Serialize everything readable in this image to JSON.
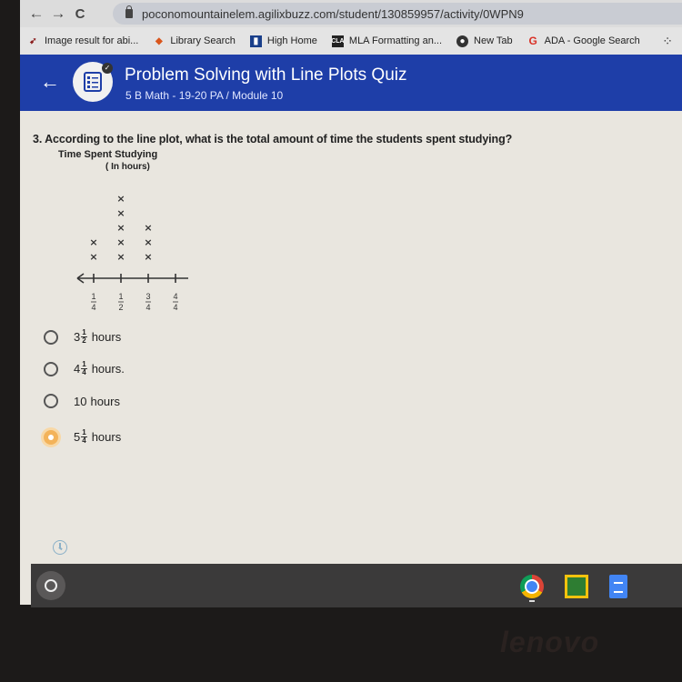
{
  "browser": {
    "url": "poconomountainelem.agilixbuzz.com/student/130859957/activity/0WPN9",
    "bookmarks": [
      {
        "label": "Image result for abi...",
        "icon": "arrow-bookmark-icon"
      },
      {
        "label": "Library Search",
        "icon": "diamond-icon"
      },
      {
        "label": "High Home",
        "icon": "building-icon"
      },
      {
        "label": "MLA Formatting an...",
        "icon": "cla-icon"
      },
      {
        "label": "New Tab",
        "icon": "globe-icon"
      },
      {
        "label": "ADA - Google Search",
        "icon": "google-icon"
      }
    ],
    "nav": {
      "back": "←",
      "forward": "→",
      "reload": "C"
    }
  },
  "header": {
    "back": "←",
    "title": "Problem Solving with Line Plots Quiz",
    "subtitle": "5 B Math - 19-20 PA / Module 10"
  },
  "question": {
    "text": "3. According to the line plot, what is the total amount of time the students spent studying?",
    "plot_title": "Time Spent Studying",
    "plot_subtitle": "( In hours)"
  },
  "chart_data": {
    "type": "scatter",
    "subtype": "line-plot",
    "title": "Time Spent Studying",
    "subtitle": "( In hours)",
    "categories": [
      "1/4",
      "1/2",
      "3/4",
      "4/4"
    ],
    "tick_labels": [
      {
        "num": "1",
        "den": "4"
      },
      {
        "num": "1",
        "den": "2"
      },
      {
        "num": "3",
        "den": "4"
      },
      {
        "num": "4",
        "den": "4"
      }
    ],
    "counts": [
      2,
      5,
      3,
      0
    ],
    "marker": "×"
  },
  "options": [
    {
      "whole": "3",
      "num": "1",
      "den": "2",
      "suffix": "hours",
      "selected": false
    },
    {
      "whole": "4",
      "num": "1",
      "den": "4",
      "suffix": "hours.",
      "selected": false
    },
    {
      "whole": "10",
      "num": "",
      "den": "",
      "suffix": "hours",
      "selected": false
    },
    {
      "whole": "5",
      "num": "1",
      "den": "4",
      "suffix": "hours",
      "selected": true
    }
  ],
  "device": {
    "brand": "lenovo"
  }
}
